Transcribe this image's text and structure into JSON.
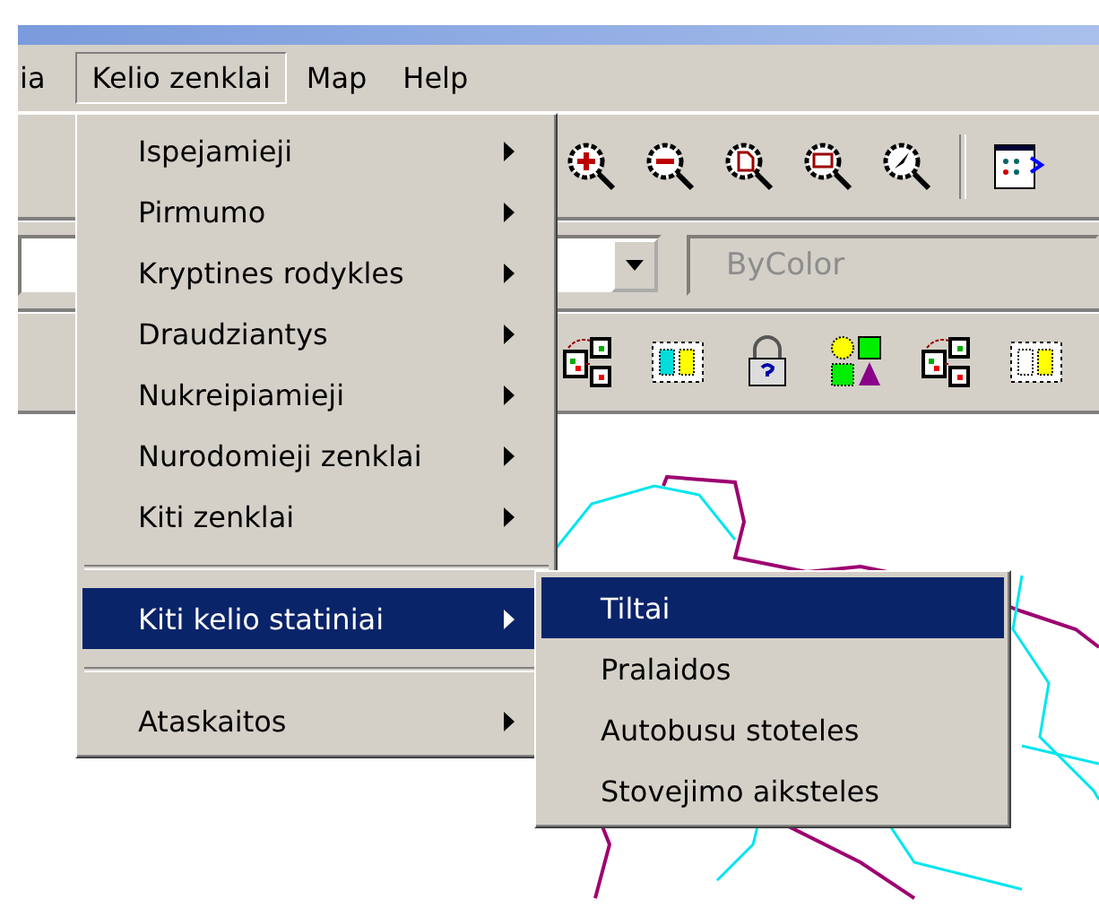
{
  "menu_bar": [
    {
      "label": "ia",
      "selected": false
    },
    {
      "label": "Kelio zenklai",
      "selected": true
    },
    {
      "label": "Map",
      "selected": false
    },
    {
      "label": "Help",
      "selected": false
    }
  ],
  "style_combo": {
    "value": "ByColor",
    "disabled": true
  },
  "dropdown_menu": {
    "items": [
      {
        "kind": "item",
        "label": "Ispejamieji",
        "submenu": true,
        "selected": false
      },
      {
        "kind": "item",
        "label": "Pirmumo",
        "submenu": true,
        "selected": false
      },
      {
        "kind": "item",
        "label": "Kryptines rodykles",
        "submenu": true,
        "selected": false
      },
      {
        "kind": "item",
        "label": "Draudziantys",
        "submenu": true,
        "selected": false
      },
      {
        "kind": "item",
        "label": "Nukreipiamieji",
        "submenu": true,
        "selected": false
      },
      {
        "kind": "item",
        "label": "Nurodomieji zenklai",
        "submenu": true,
        "selected": false
      },
      {
        "kind": "item",
        "label": "Kiti zenklai",
        "submenu": true,
        "selected": false
      },
      {
        "kind": "separator"
      },
      {
        "kind": "item",
        "label": "Kiti kelio statiniai",
        "submenu": true,
        "selected": true
      },
      {
        "kind": "separator"
      },
      {
        "kind": "item",
        "label": "Ataskaitos",
        "submenu": true,
        "selected": false
      }
    ]
  },
  "submenu": {
    "items": [
      {
        "label": "Tiltai",
        "selected": true
      },
      {
        "label": "Pralaidos",
        "selected": false
      },
      {
        "label": "Autobusu stoteles",
        "selected": false
      },
      {
        "label": "Stovejimo aiksteles",
        "selected": false
      }
    ]
  }
}
